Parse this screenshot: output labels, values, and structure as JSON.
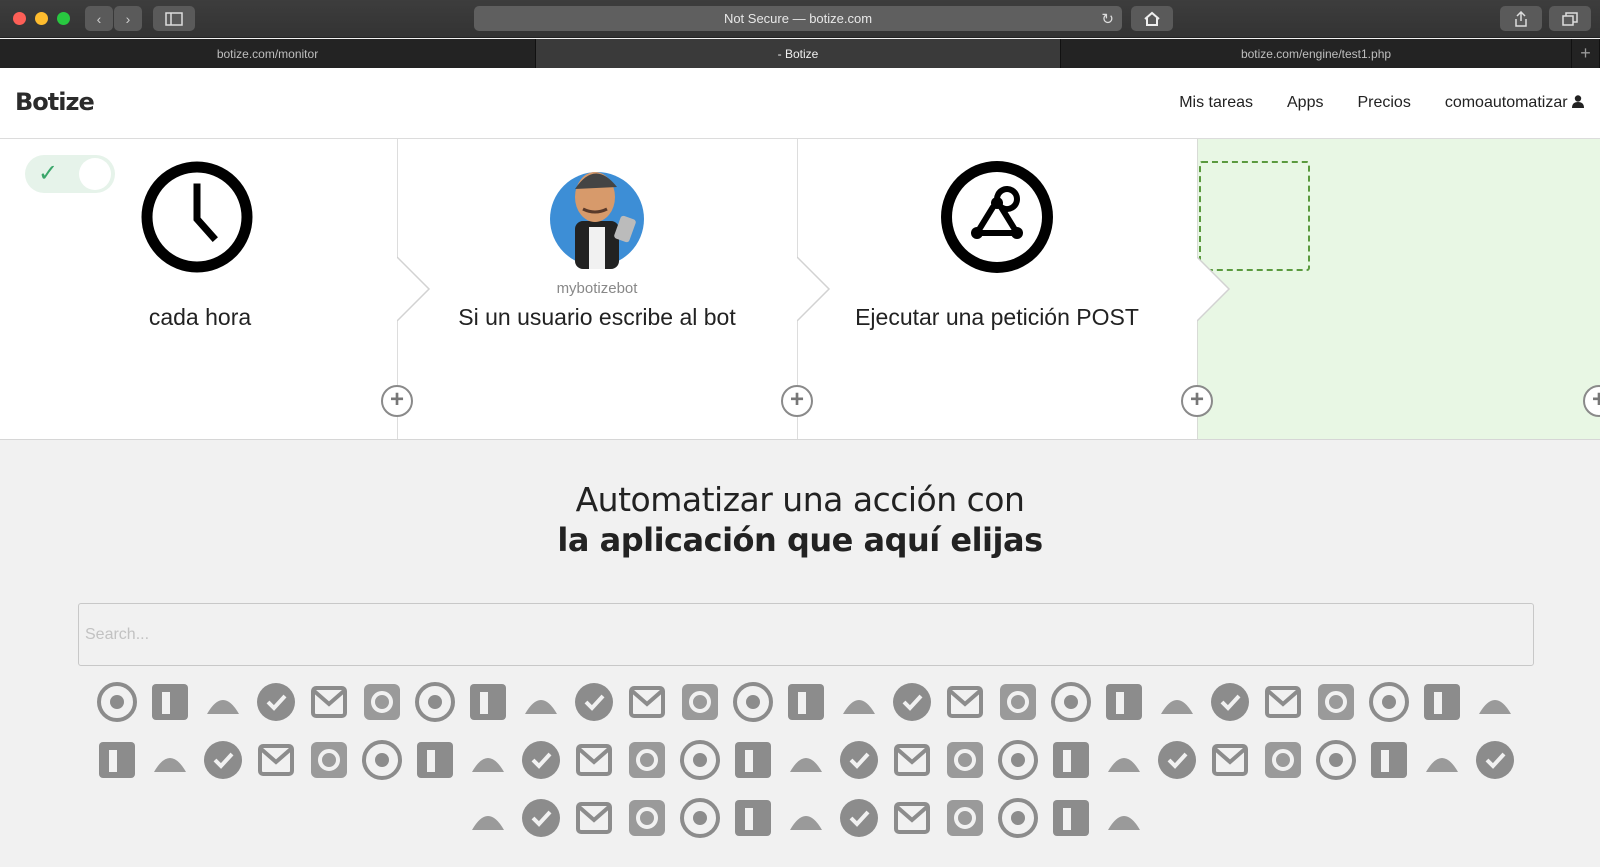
{
  "browser": {
    "address": "Not Secure — botize.com",
    "tabs": [
      {
        "label": "botize.com/monitor"
      },
      {
        "label": "- Botize"
      },
      {
        "label": "botize.com/engine/test1.php"
      }
    ],
    "new_tab": "+"
  },
  "header": {
    "logo": "Botize",
    "nav": {
      "tasks": "Mis tareas",
      "apps": "Apps",
      "pricing": "Precios",
      "user": "comoautomatizar"
    }
  },
  "steps": [
    {
      "text": "cada hora",
      "icon": "clock-icon"
    },
    {
      "text": "Si un usuario escribe al bot",
      "sub": "mybotizebot",
      "icon": "bot-avatar"
    },
    {
      "text": "Ejecutar una petición POST",
      "icon": "webhook-icon"
    },
    {
      "text": "",
      "icon": "empty-slot"
    }
  ],
  "toggle": {
    "state": "on",
    "icon": "check-icon"
  },
  "headline": {
    "line1": "Automatizar una acción con",
    "line2": "la aplicación que aquí elijas"
  },
  "search": {
    "placeholder": "Search...",
    "value": ""
  },
  "app_icons": {
    "row1": [
      "twitter-icon",
      "rss-icon",
      "facebook-pages-icon",
      "lab-icon",
      "instagram-icon",
      "facebook-icon",
      "youtube-icon",
      "yahoo-weather-icon",
      "botize-bot-icon",
      "gmail-icon",
      "tumblr-icon",
      "touch-icon",
      "wordpress-xmlrpc-icon",
      "dropbox-icon",
      "calendar-icon",
      "google-drive-icon",
      "blogger-icon",
      "pinterest-icon",
      "pushpin-icon",
      "botize-icon",
      "pocket-icon",
      "email-at-icon",
      "sms-icon",
      "evernote-icon",
      "webhook-icon",
      "todo-check-icon",
      "spreadsheet-icon"
    ],
    "row2": [
      "slack-icon",
      "linkedin-icon",
      "magnet-icon",
      "mail-icon",
      "gmail-alt-icon",
      "zoho-projects-icon",
      "filter-icon",
      "instapaper-icon",
      "buffer-icon",
      "appstore-icon",
      "chat-icon",
      "list-icon",
      "thumbs-up-icon",
      "contact-icon",
      "outlook-icon",
      "document-icon",
      "ftp-icon",
      "brush-icon",
      "analytics-icon",
      "messenger-icon",
      "wordpress-com-icon",
      "trello-icon",
      "blocks-icon",
      "bar-chart-icon",
      "puzzle-icon",
      "bing-icon",
      "mysql-icon"
    ],
    "row3": [
      "database-icon",
      "zendesk-icon",
      "gauge-icon",
      "office-icon",
      "clock-outline-icon",
      "group-icon",
      "feedly-icon",
      "selenium-icon",
      "wordpress-alt-icon",
      "sync-icon",
      "notes-icon",
      "box-icon",
      "news-icon"
    ]
  },
  "colors": {
    "accent": "#3aa66a",
    "slot_bg": "#e8f7e4",
    "slot_border": "#5a9a3e"
  }
}
